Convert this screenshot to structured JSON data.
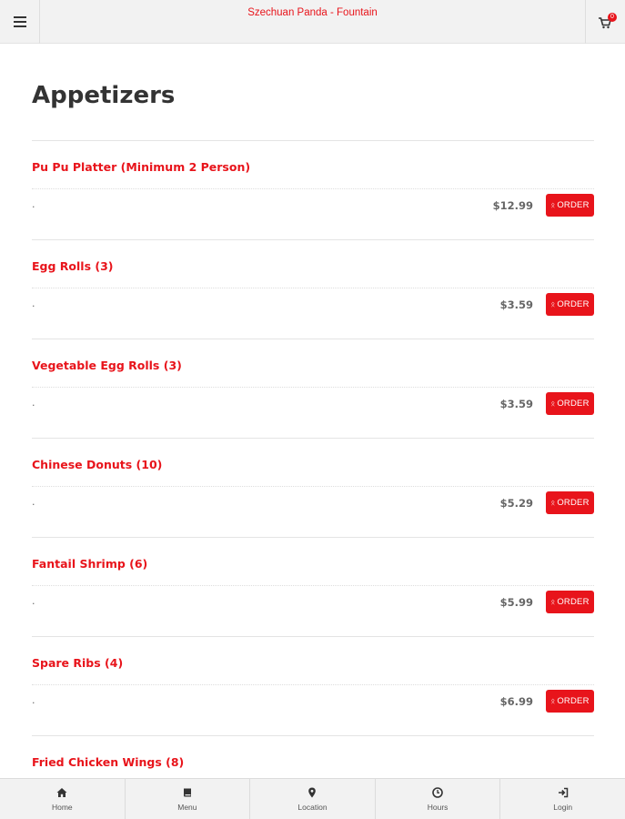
{
  "header": {
    "title": "Szechuan Panda - Fountain",
    "cart_count": "0",
    "menu_icon": "hamburger-icon",
    "cart_icon": "cart-icon"
  },
  "page": {
    "title": "Appetizers"
  },
  "colors": {
    "accent": "#e8141b",
    "bar_bg": "#f2f2f2",
    "text": "#333333"
  },
  "items": [
    {
      "name": "Pu Pu Platter (Minimum 2 Person)",
      "desc": ".",
      "price": "$12.99",
      "order_label": "ORDER"
    },
    {
      "name": "Egg Rolls (3)",
      "desc": ".",
      "price": "$3.59",
      "order_label": "ORDER"
    },
    {
      "name": "Vegetable Egg Rolls (3)",
      "desc": ".",
      "price": "$3.59",
      "order_label": "ORDER"
    },
    {
      "name": "Chinese Donuts (10)",
      "desc": ".",
      "price": "$5.29",
      "order_label": "ORDER"
    },
    {
      "name": "Fantail Shrimp (6)",
      "desc": ".",
      "price": "$5.99",
      "order_label": "ORDER"
    },
    {
      "name": "Spare Ribs (4)",
      "desc": ".",
      "price": "$6.99",
      "order_label": "ORDER"
    },
    {
      "name": "Fried Chicken Wings (8)"
    }
  ],
  "nav": [
    {
      "label": "Home",
      "icon": "home-icon"
    },
    {
      "label": "Menu",
      "icon": "book-icon"
    },
    {
      "label": "Location",
      "icon": "map-pin-icon"
    },
    {
      "label": "Hours",
      "icon": "clock-icon"
    },
    {
      "label": "Login",
      "icon": "login-icon"
    }
  ]
}
